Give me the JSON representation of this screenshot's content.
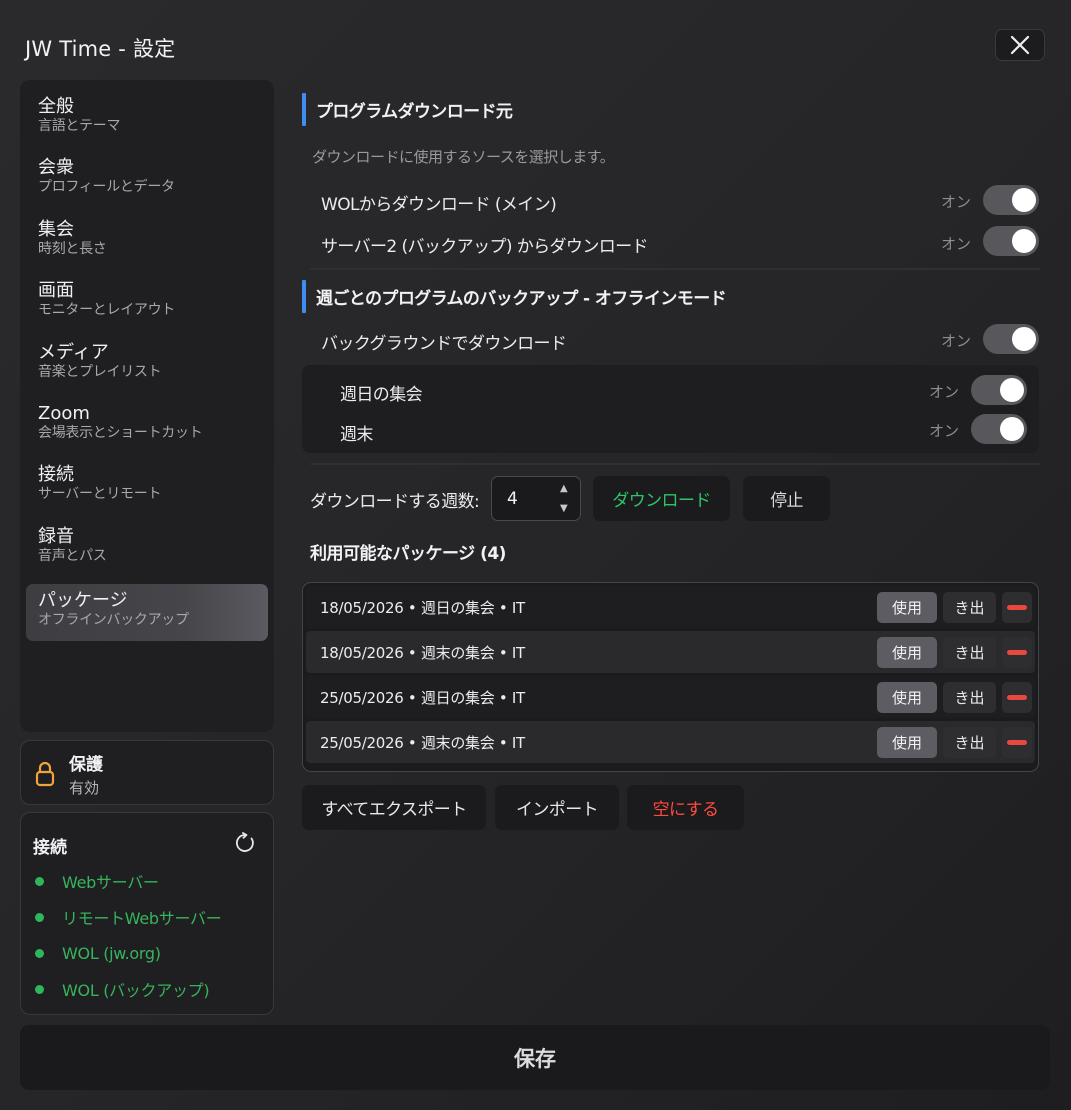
{
  "window": {
    "title": "JW Time - 設定"
  },
  "sidebar": {
    "items": [
      {
        "title": "全般",
        "subtitle": "言語とテーマ"
      },
      {
        "title": "会衆",
        "subtitle": "プロフィールとデータ"
      },
      {
        "title": "集会",
        "subtitle": "時刻と長さ"
      },
      {
        "title": "画面",
        "subtitle": "モニターとレイアウト"
      },
      {
        "title": "メディア",
        "subtitle": "音楽とプレイリスト"
      },
      {
        "title": "Zoom",
        "subtitle": "会場表示とショートカット"
      },
      {
        "title": "接続",
        "subtitle": "サーバーとリモート"
      },
      {
        "title": "録音",
        "subtitle": "音声とパス"
      },
      {
        "title": "パッケージ",
        "subtitle": "オフラインバックアップ"
      }
    ],
    "active_index": 8
  },
  "protection": {
    "title": "保護",
    "status": "有効"
  },
  "connections": {
    "title": "接続",
    "items": [
      {
        "label": "Webサーバー",
        "status": "ok"
      },
      {
        "label": "リモートWebサーバー",
        "status": "ok"
      },
      {
        "label": "WOL (jw.org)",
        "status": "ok"
      },
      {
        "label": "WOL (バックアップ)",
        "status": "ok"
      }
    ]
  },
  "source": {
    "title": "プログラムダウンロード元",
    "description": "ダウンロードに使用するソースを選択します。",
    "options": [
      {
        "label": "WOLからダウンロード (メイン)",
        "state_label": "オン",
        "enabled": true
      },
      {
        "label": "サーバー2 (バックアップ) からダウンロード",
        "state_label": "オン",
        "enabled": true
      }
    ]
  },
  "backup": {
    "title": "週ごとのプログラムのバックアップ - オフラインモード",
    "background": {
      "label": "バックグラウンドでダウンロード",
      "state_label": "オン",
      "enabled": true
    },
    "meetings": [
      {
        "label": "週日の集会",
        "state_label": "オン",
        "enabled": true
      },
      {
        "label": "週末",
        "state_label": "オン",
        "enabled": true
      }
    ],
    "weeks_label": "ダウンロードする週数:",
    "weeks_value": "4",
    "download_label": "ダウンロード",
    "stop_label": "停止"
  },
  "packages": {
    "title": "利用可能なパッケージ (4)",
    "use_label": "使用",
    "export_label": "き出",
    "rows": [
      {
        "label": "18/05/2026 • 週日の集会 • IT"
      },
      {
        "label": "18/05/2026 • 週末の集会 • IT"
      },
      {
        "label": "25/05/2026 • 週日の集会 • IT"
      },
      {
        "label": "25/05/2026 • 週末の集会 • IT"
      }
    ],
    "export_all_label": "すべてエクスポート",
    "import_label": "インポート",
    "clear_label": "空にする"
  },
  "footer": {
    "save_label": "保存"
  },
  "colors": {
    "accent": "#3d8ef0",
    "success": "#36b45c",
    "danger": "#e8483e",
    "download_text": "#2ec46a",
    "clear_text": "#ff4a3d"
  }
}
